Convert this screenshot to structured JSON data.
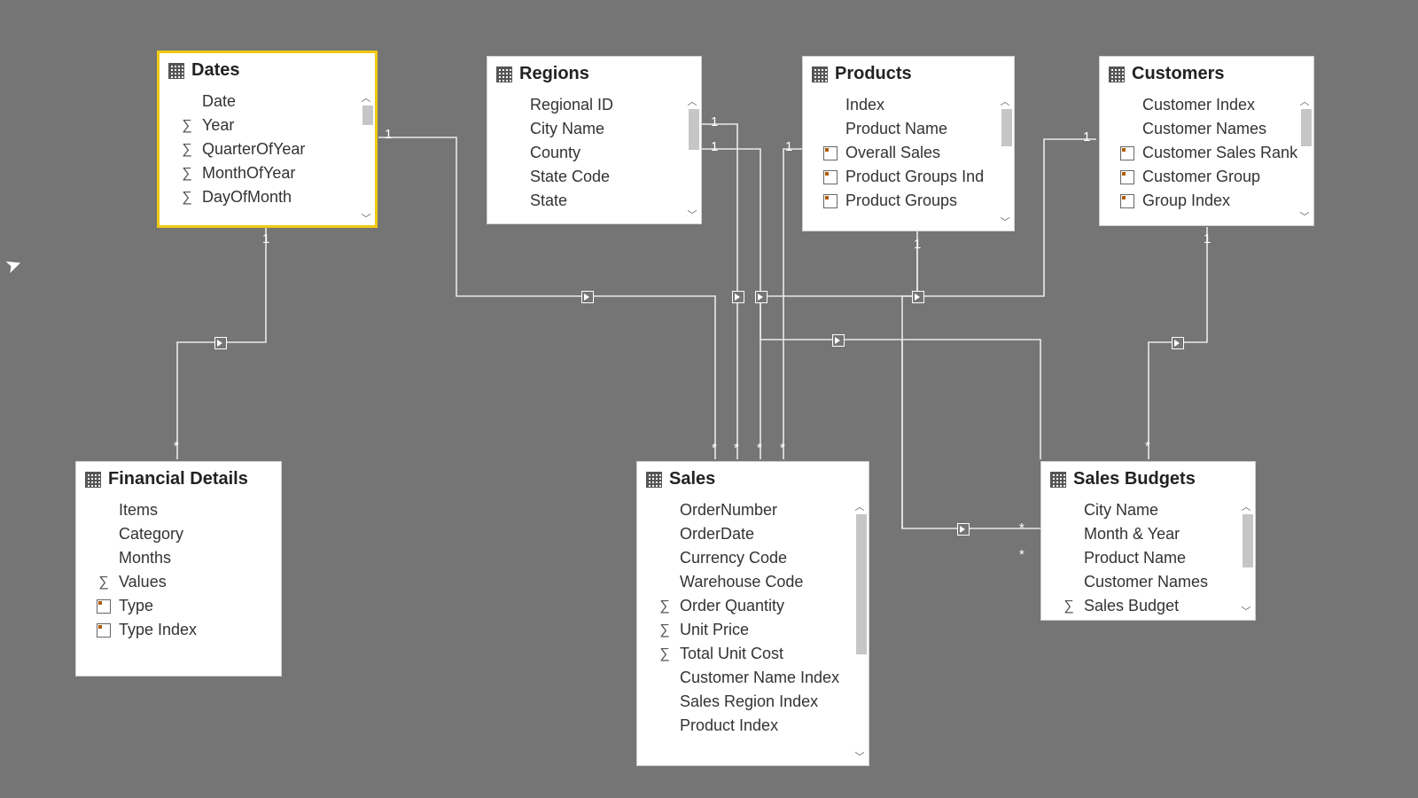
{
  "tables": {
    "dates": {
      "title": "Dates",
      "selected": true,
      "fields": [
        {
          "label": "Date",
          "icon": ""
        },
        {
          "label": "Year",
          "icon": "sigma"
        },
        {
          "label": "QuarterOfYear",
          "icon": "sigma"
        },
        {
          "label": "MonthOfYear",
          "icon": "sigma"
        },
        {
          "label": "DayOfMonth",
          "icon": "sigma"
        }
      ]
    },
    "regions": {
      "title": "Regions",
      "fields": [
        {
          "label": "Regional ID",
          "icon": ""
        },
        {
          "label": "City Name",
          "icon": ""
        },
        {
          "label": "County",
          "icon": ""
        },
        {
          "label": "State Code",
          "icon": ""
        },
        {
          "label": "State",
          "icon": ""
        }
      ]
    },
    "products": {
      "title": "Products",
      "fields": [
        {
          "label": "Index",
          "icon": ""
        },
        {
          "label": "Product Name",
          "icon": ""
        },
        {
          "label": "Overall Sales",
          "icon": "calc"
        },
        {
          "label": "Product Groups Ind",
          "icon": "calc"
        },
        {
          "label": "Product Groups",
          "icon": "calc"
        }
      ]
    },
    "customers": {
      "title": "Customers",
      "fields": [
        {
          "label": "Customer Index",
          "icon": ""
        },
        {
          "label": "Customer Names",
          "icon": ""
        },
        {
          "label": "Customer Sales Rank",
          "icon": "calc"
        },
        {
          "label": "Customer Group",
          "icon": "calc"
        },
        {
          "label": "Group Index",
          "icon": "calc"
        }
      ]
    },
    "financial": {
      "title": "Financial Details",
      "fields": [
        {
          "label": "Items",
          "icon": ""
        },
        {
          "label": "Category",
          "icon": ""
        },
        {
          "label": "Months",
          "icon": ""
        },
        {
          "label": "Values",
          "icon": "sigma"
        },
        {
          "label": "Type",
          "icon": "calc"
        },
        {
          "label": "Type Index",
          "icon": "calc"
        }
      ]
    },
    "sales": {
      "title": "Sales",
      "fields": [
        {
          "label": "OrderNumber",
          "icon": ""
        },
        {
          "label": "OrderDate",
          "icon": ""
        },
        {
          "label": "Currency Code",
          "icon": ""
        },
        {
          "label": "Warehouse Code",
          "icon": ""
        },
        {
          "label": "Order Quantity",
          "icon": "sigma"
        },
        {
          "label": "Unit Price",
          "icon": "sigma"
        },
        {
          "label": "Total Unit Cost",
          "icon": "sigma"
        },
        {
          "label": "Customer Name Index",
          "icon": ""
        },
        {
          "label": "Sales Region Index",
          "icon": ""
        },
        {
          "label": "Product Index",
          "icon": ""
        }
      ]
    },
    "budgets": {
      "title": "Sales Budgets",
      "fields": [
        {
          "label": "City Name",
          "icon": ""
        },
        {
          "label": "Month & Year",
          "icon": ""
        },
        {
          "label": "Product Name",
          "icon": ""
        },
        {
          "label": "Customer Names",
          "icon": ""
        },
        {
          "label": "Sales Budget",
          "icon": "sigma"
        }
      ]
    }
  },
  "relationships": [
    {
      "from": "dates",
      "to": "financial",
      "from_card": "1",
      "to_card": "*"
    },
    {
      "from": "dates",
      "to": "sales",
      "from_card": "1",
      "to_card": "*"
    },
    {
      "from": "regions",
      "to": "sales",
      "from_card": "1",
      "to_card": "*"
    },
    {
      "from": "regions",
      "to": "sales_budgets",
      "from_card": "1",
      "to_card": "*"
    },
    {
      "from": "products",
      "to": "sales",
      "from_card": "1",
      "to_card": "*"
    },
    {
      "from": "products",
      "to": "sales_budgets",
      "from_card": "1",
      "to_card": "*"
    },
    {
      "from": "customers",
      "to": "sales",
      "from_card": "1",
      "to_card": "*"
    },
    {
      "from": "customers",
      "to": "sales_budgets",
      "from_card": "1",
      "to_card": "*"
    }
  ],
  "cardinality_symbols": {
    "one": "1",
    "many": "*"
  }
}
